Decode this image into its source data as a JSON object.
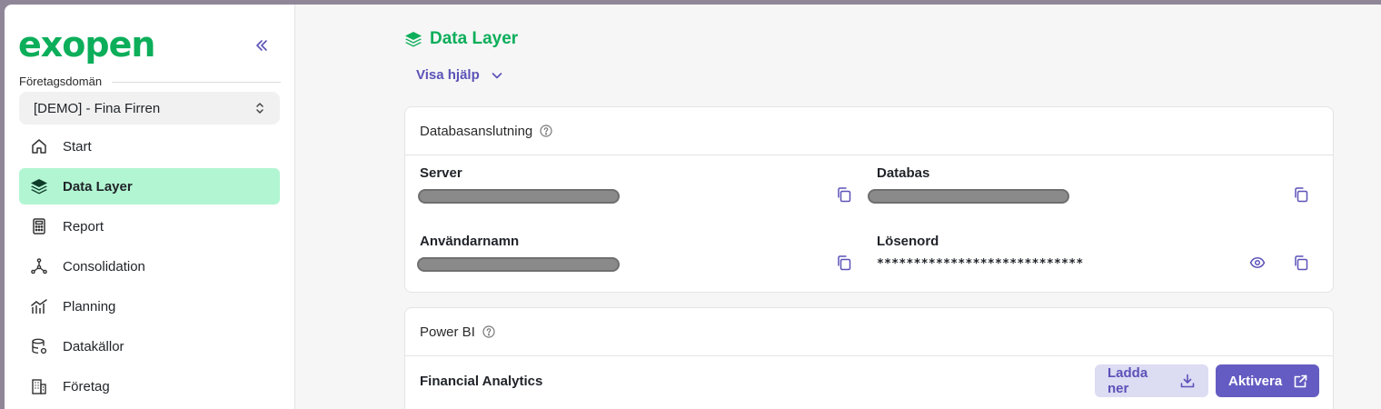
{
  "sidebar": {
    "logo": "exopen",
    "domain_label": "Företagsdomän",
    "domain_value": "[DEMO] - Fina Firren",
    "items": [
      {
        "label": "Start",
        "icon": "home-icon"
      },
      {
        "label": "Data Layer",
        "icon": "layers-icon",
        "active": true
      },
      {
        "label": "Report",
        "icon": "calculator-icon"
      },
      {
        "label": "Consolidation",
        "icon": "network-icon"
      },
      {
        "label": "Planning",
        "icon": "chart-icon"
      },
      {
        "label": "Datakällor",
        "icon": "database-icon"
      },
      {
        "label": "Företag",
        "icon": "building-icon"
      }
    ]
  },
  "main": {
    "title": "Data Layer",
    "help_toggle": "Visa hjälp",
    "db_card": {
      "title": "Databasanslutning",
      "server_label": "Server",
      "database_label": "Databas",
      "username_label": "Användarnamn",
      "password_label": "Lösenord",
      "password_value": "****************************"
    },
    "powerbi_card": {
      "title": "Power BI",
      "row_title": "Financial Analytics",
      "download_label": "Ladda ner",
      "activate_label": "Aktivera"
    }
  },
  "colors": {
    "brand_green": "#0cae5a",
    "active_nav_bg": "#b2f5d3",
    "accent_purple": "#645cc2",
    "secondary_button_bg": "#dcdcf3"
  }
}
